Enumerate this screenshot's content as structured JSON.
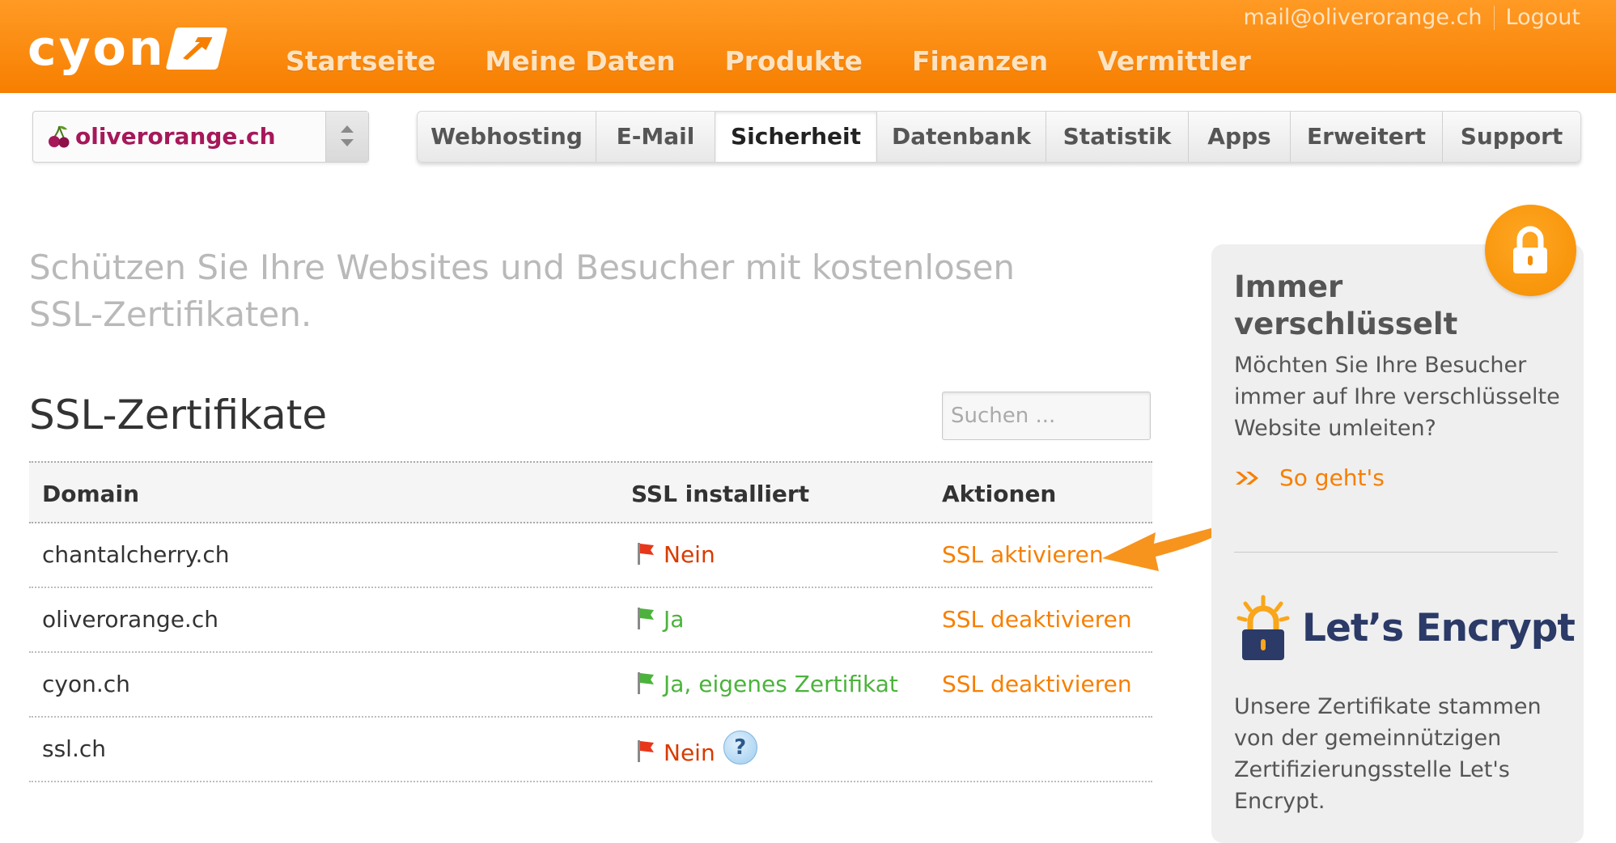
{
  "header": {
    "logo_text": "cyon",
    "nav": [
      "Startseite",
      "Meine Daten",
      "Produkte",
      "Finanzen",
      "Vermittler"
    ],
    "user_email": "mail@oliverorange.ch",
    "logout_label": "Logout"
  },
  "domain_select": {
    "value": "oliverorange.ch"
  },
  "tabs": [
    {
      "label": "Webhosting",
      "active": false
    },
    {
      "label": "E-Mail",
      "active": false
    },
    {
      "label": "Sicherheit",
      "active": true
    },
    {
      "label": "Datenbank",
      "active": false
    },
    {
      "label": "Statistik",
      "active": false
    },
    {
      "label": "Apps",
      "active": false
    },
    {
      "label": "Erweitert",
      "active": false
    },
    {
      "label": "Support",
      "active": false
    }
  ],
  "main": {
    "intro": "Schützen Sie Ihre Websites und Besucher mit kostenlosen SSL-Zertifikaten.",
    "title": "SSL-Zertifikate",
    "search_placeholder": "Suchen ...",
    "table": {
      "headers": [
        "Domain",
        "SSL installiert",
        "Aktionen"
      ],
      "rows": [
        {
          "domain": "chantalcherry.ch",
          "ssl": "Nein",
          "action": "SSL aktivieren"
        },
        {
          "domain": "oliverorange.ch",
          "ssl": "Ja",
          "action": "SSL deaktivieren"
        },
        {
          "domain": "cyon.ch",
          "ssl": "Ja, eigenes Zertifikat",
          "action": "SSL deaktivieren"
        },
        {
          "domain": "ssl.ch",
          "ssl": "Nein",
          "action": ""
        }
      ]
    }
  },
  "sidebar": {
    "title": "Immer verschlüsselt",
    "text": "Möchten Sie Ihre Besucher immer auf Ihre verschlüsselte Website umleiten?",
    "link": "So geht's",
    "logo_text": "Let’s Encrypt",
    "text2": "Unsere Zertifikate stammen von der gemeinnützigen Zertifizierungsstelle Let's Encrypt."
  },
  "colors": {
    "brand_orange": "#f77f00",
    "status_no": "#d93a00",
    "status_yes": "#4bb33c",
    "domain_select_text": "#a6185a",
    "lets_encrypt_blue": "#2b3a67",
    "lets_encrypt_yellow": "#f9a61a"
  },
  "icons": {
    "status_no": "red-flag-icon",
    "status_yes": "green-flag-icon",
    "help": "question-icon",
    "lock": "lock-icon",
    "link_prefix": "double-chevron-icon"
  }
}
